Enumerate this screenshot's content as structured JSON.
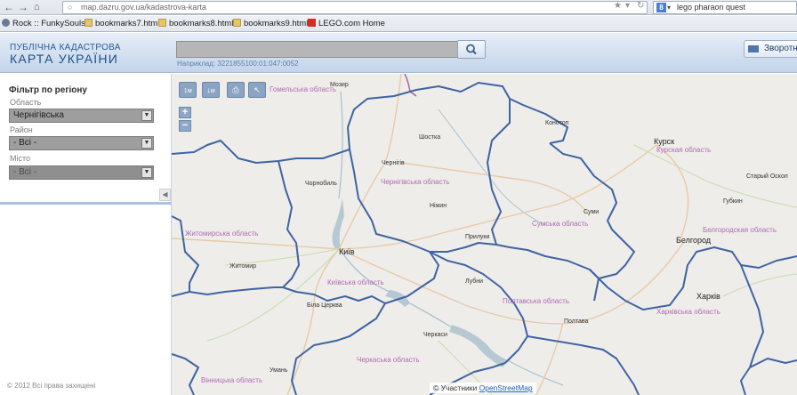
{
  "browser": {
    "url": "map.dazru.gov.ua/kadastrova-karta",
    "search_query": "lego pharaon quest",
    "search_engine_letter": "8"
  },
  "bookmarks": [
    {
      "label": "Rock :: FunkySouls",
      "icon": "site-icon"
    },
    {
      "label": "bookmarks7.html",
      "icon": "folder-icon"
    },
    {
      "label": "bookmarks8.html",
      "icon": "folder-icon"
    },
    {
      "label": "bookmarks9.html",
      "icon": "folder-icon"
    },
    {
      "label": "LEGO.com Home",
      "icon": "lego-icon"
    }
  ],
  "header": {
    "title_line1": "ПУБЛІЧНА КАДАСТРОВА",
    "title_line2": "КАРТА УКРАЇНИ",
    "search_value": "",
    "hint": "Наприклад: 3221855100:01:047:0052",
    "feedback_label": "Зворотній зв'язок"
  },
  "sidebar": {
    "filter_title": "Фільтр по регіону",
    "oblast_label": "Область",
    "oblast_value": "Чернігівська",
    "rayon_label": "Район",
    "rayon_value": "- Всі -",
    "city_label": "Місто",
    "city_value": "- Всі -",
    "copyright": "© 2012 Всі права захищені"
  },
  "map": {
    "attribution_prefix": "© Участники",
    "attribution_link": "OpenStreetMap",
    "labels": {
      "kursk": "Курск",
      "kurskaya": "Курская область",
      "chernihiv_obl": "Чернігівська область",
      "chernihiv": "Чернігів",
      "sumy_obl": "Сумська область",
      "sumy": "Суми",
      "belgorod": "Белгород",
      "belgorodskaya": "Белгородская область",
      "zhytomyr_obl": "Житомирська область",
      "zhytomyr": "Житомир",
      "kyiv": "Київ",
      "kyiv_obl": "Київська область",
      "bila_tserkva": "Біла Церква",
      "poltava_obl": "Полтавська область",
      "poltava": "Полтава",
      "cherkasy": "Черкаси",
      "cherkasy_obl": "Черкаська область",
      "vinnytsia_obl": "Вінницька область",
      "kharkiv_obl": "Харківська область",
      "kharkiv": "Харків",
      "stary_oskol": "Старый Оскол",
      "oskol": "Губкин",
      "chernobyl": "Чорнобиль",
      "nizhyn": "Ніжин",
      "konotop": "Конотоп",
      "shostka": "Шостка",
      "lubny": "Лубни",
      "pryluky": "Прилуки",
      "uman": "Умань",
      "gomel_obl": "Гомельська область",
      "belarus_city": "Мозир"
    }
  }
}
